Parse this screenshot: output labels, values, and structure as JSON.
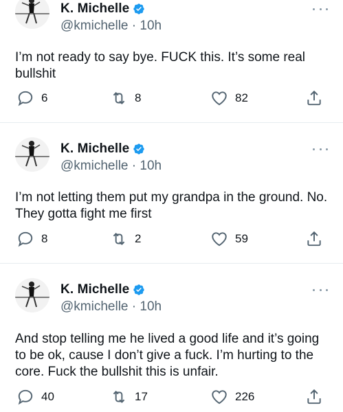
{
  "tweets": [
    {
      "name": "K. Michelle",
      "handle": "@kmichelle",
      "time": "10h",
      "text": "I’m not ready to say bye. FUCK this. It’s some real bullshit",
      "replies": "6",
      "retweets": "8",
      "likes": "82"
    },
    {
      "name": "K. Michelle",
      "handle": "@kmichelle",
      "time": "10h",
      "text": "I’m not letting them put my grandpa in the ground. No. They gotta fight me first",
      "replies": "8",
      "retweets": "2",
      "likes": "59"
    },
    {
      "name": "K. Michelle",
      "handle": "@kmichelle",
      "time": "10h",
      "text": "And stop telling me he lived a good life and it’s going to be ok, cause I don’t give a fuck. I’m hurting to the core. Fuck the bullshit this is unfair.",
      "replies": "40",
      "retweets": "17",
      "likes": "226"
    }
  ],
  "colors": {
    "verified": "#1d9bf0",
    "secondary_text": "#536471",
    "primary_text": "#0f1419",
    "divider": "#e6ecf0"
  },
  "icons": {
    "reply": "speech-bubble",
    "retweet": "retweet-arrows",
    "like": "heart-outline",
    "share": "share-arrow-up",
    "more": "three-dots"
  }
}
